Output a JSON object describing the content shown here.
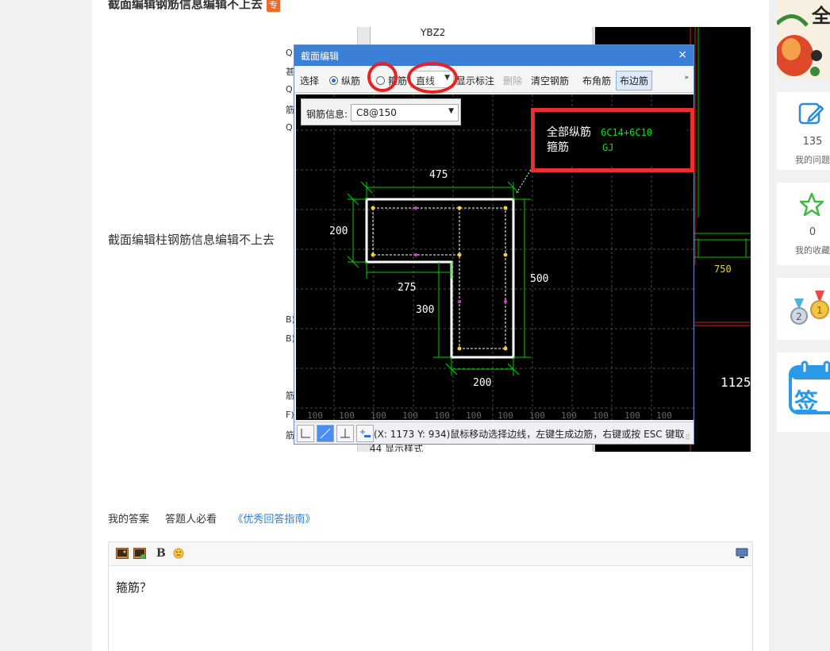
{
  "question": {
    "title": "截面编辑钢筋信息编辑不上去",
    "badge": "专",
    "body": "截面编辑柱钢筋信息编辑不上去"
  },
  "screenshot": {
    "bg_letters": [
      "Q",
      "甚",
      "Q",
      "筋",
      "Q",
      "B)",
      "B)",
      "筋",
      "F)",
      "筋"
    ],
    "bg_list_head": "YBZ2",
    "bg_list_foot": "44  显示样式",
    "bg_cad_labels": [
      "750",
      "1125"
    ],
    "dialog": {
      "title": "截面编辑",
      "close": "×",
      "toolbar": {
        "select": "选择",
        "longitudinal": "纵筋",
        "stirrup": "箍筋",
        "line_mode": "直线",
        "show_annotation": "显示标注",
        "delete": "删除",
        "clear_rebar": "清空钢筋",
        "corner_rebar": "布角筋",
        "edge_rebar": "布边筋",
        "more": "»"
      },
      "rebar_info": {
        "label": "钢筋信息:",
        "value": "C8@150"
      },
      "annotation": {
        "all_longitudinal_label": "全部纵筋",
        "all_longitudinal_value": "6C14+6C10",
        "stirrup_label": "箍筋",
        "stirrup_value": "GJ"
      },
      "dimensions": [
        "475",
        "200",
        "275",
        "500",
        "300",
        "200"
      ],
      "grid_labels": [
        "100",
        "100",
        "100",
        "100",
        "100",
        "100",
        "100",
        "100",
        "100",
        "100",
        "100",
        "100"
      ],
      "status_text": "(X: 1173 Y: 934)鼠标移动选择边线，左键生成边筋，右键或按 ESC 键取",
      "status_tools": [
        "corner-tool",
        "diagonal-tool",
        "perpendicular-tool",
        "edge-tool"
      ]
    }
  },
  "answer": {
    "tab_my_answer": "我的答案",
    "tab_must_read": "答题人必看",
    "tab_guide": "《优秀回答指南》",
    "editor_text": "箍筋？"
  },
  "sidebar": {
    "banner_text": "全",
    "questions_count": "135",
    "questions_label": "我的问题",
    "favorites_count": "0",
    "favorites_label": "我的收藏",
    "checkin_label": "签"
  },
  "colors": {
    "accent_blue": "#3c7fd6",
    "highlight_red": "#e62222",
    "cad_green": "#00e000",
    "cad_yellow": "#e6d33a"
  }
}
